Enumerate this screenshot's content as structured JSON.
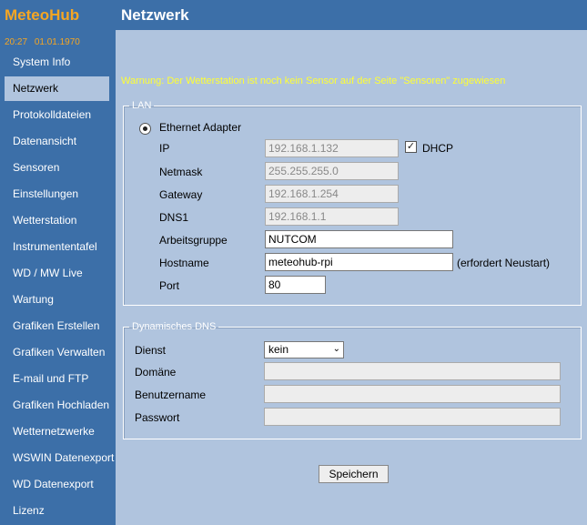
{
  "app": {
    "brand": "MeteoHub",
    "time": "20:27",
    "date": "01.01.1970",
    "accent": "#f5a623",
    "sidebar_color": "#3c6fa8",
    "content_bg": "#b0c4de"
  },
  "sidebar": {
    "items": [
      {
        "label": "System Info"
      },
      {
        "label": "Netzwerk",
        "active": true
      },
      {
        "label": "Protokolldateien"
      },
      {
        "label": "Datenansicht"
      },
      {
        "label": "Sensoren"
      },
      {
        "label": "Einstellungen"
      },
      {
        "label": "Wetterstation"
      },
      {
        "label": "Instrumententafel"
      },
      {
        "label": "WD / MW Live"
      },
      {
        "label": "Wartung"
      },
      {
        "label": "Grafiken Erstellen"
      },
      {
        "label": "Grafiken Verwalten"
      },
      {
        "label": "E-mail und FTP"
      },
      {
        "label": "Grafiken Hochladen"
      },
      {
        "label": "Wetternetzwerke"
      },
      {
        "label": "WSWIN Datenexport"
      },
      {
        "label": "WD Datenexport"
      },
      {
        "label": "Lizenz"
      }
    ]
  },
  "header": {
    "title": "Netzwerk"
  },
  "warning": "Warnung: Der Wetterstation ist noch kein Sensor auf der Seite \"Sensoren\" zugewiesen",
  "lan": {
    "legend": "LAN",
    "adapter_label": "Ethernet Adapter",
    "ip_label": "IP",
    "ip_value": "192.168.1.132",
    "dhcp_label": "DHCP",
    "dhcp_checked": true,
    "netmask_label": "Netmask",
    "netmask_value": "255.255.255.0",
    "gateway_label": "Gateway",
    "gateway_value": "192.168.1.254",
    "dns1_label": "DNS1",
    "dns1_value": "192.168.1.1",
    "workgroup_label": "Arbeitsgruppe",
    "workgroup_value": "NUTCOM",
    "hostname_label": "Hostname",
    "hostname_value": "meteohub-rpi",
    "hostname_note": "(erfordert Neustart)",
    "port_label": "Port",
    "port_value": "80"
  },
  "ddns": {
    "legend": "Dynamisches DNS",
    "service_label": "Dienst",
    "service_value": "kein",
    "domain_label": "Domäne",
    "domain_value": "",
    "username_label": "Benutzername",
    "username_value": "",
    "password_label": "Passwort",
    "password_value": ""
  },
  "actions": {
    "save_label": "Speichern"
  }
}
